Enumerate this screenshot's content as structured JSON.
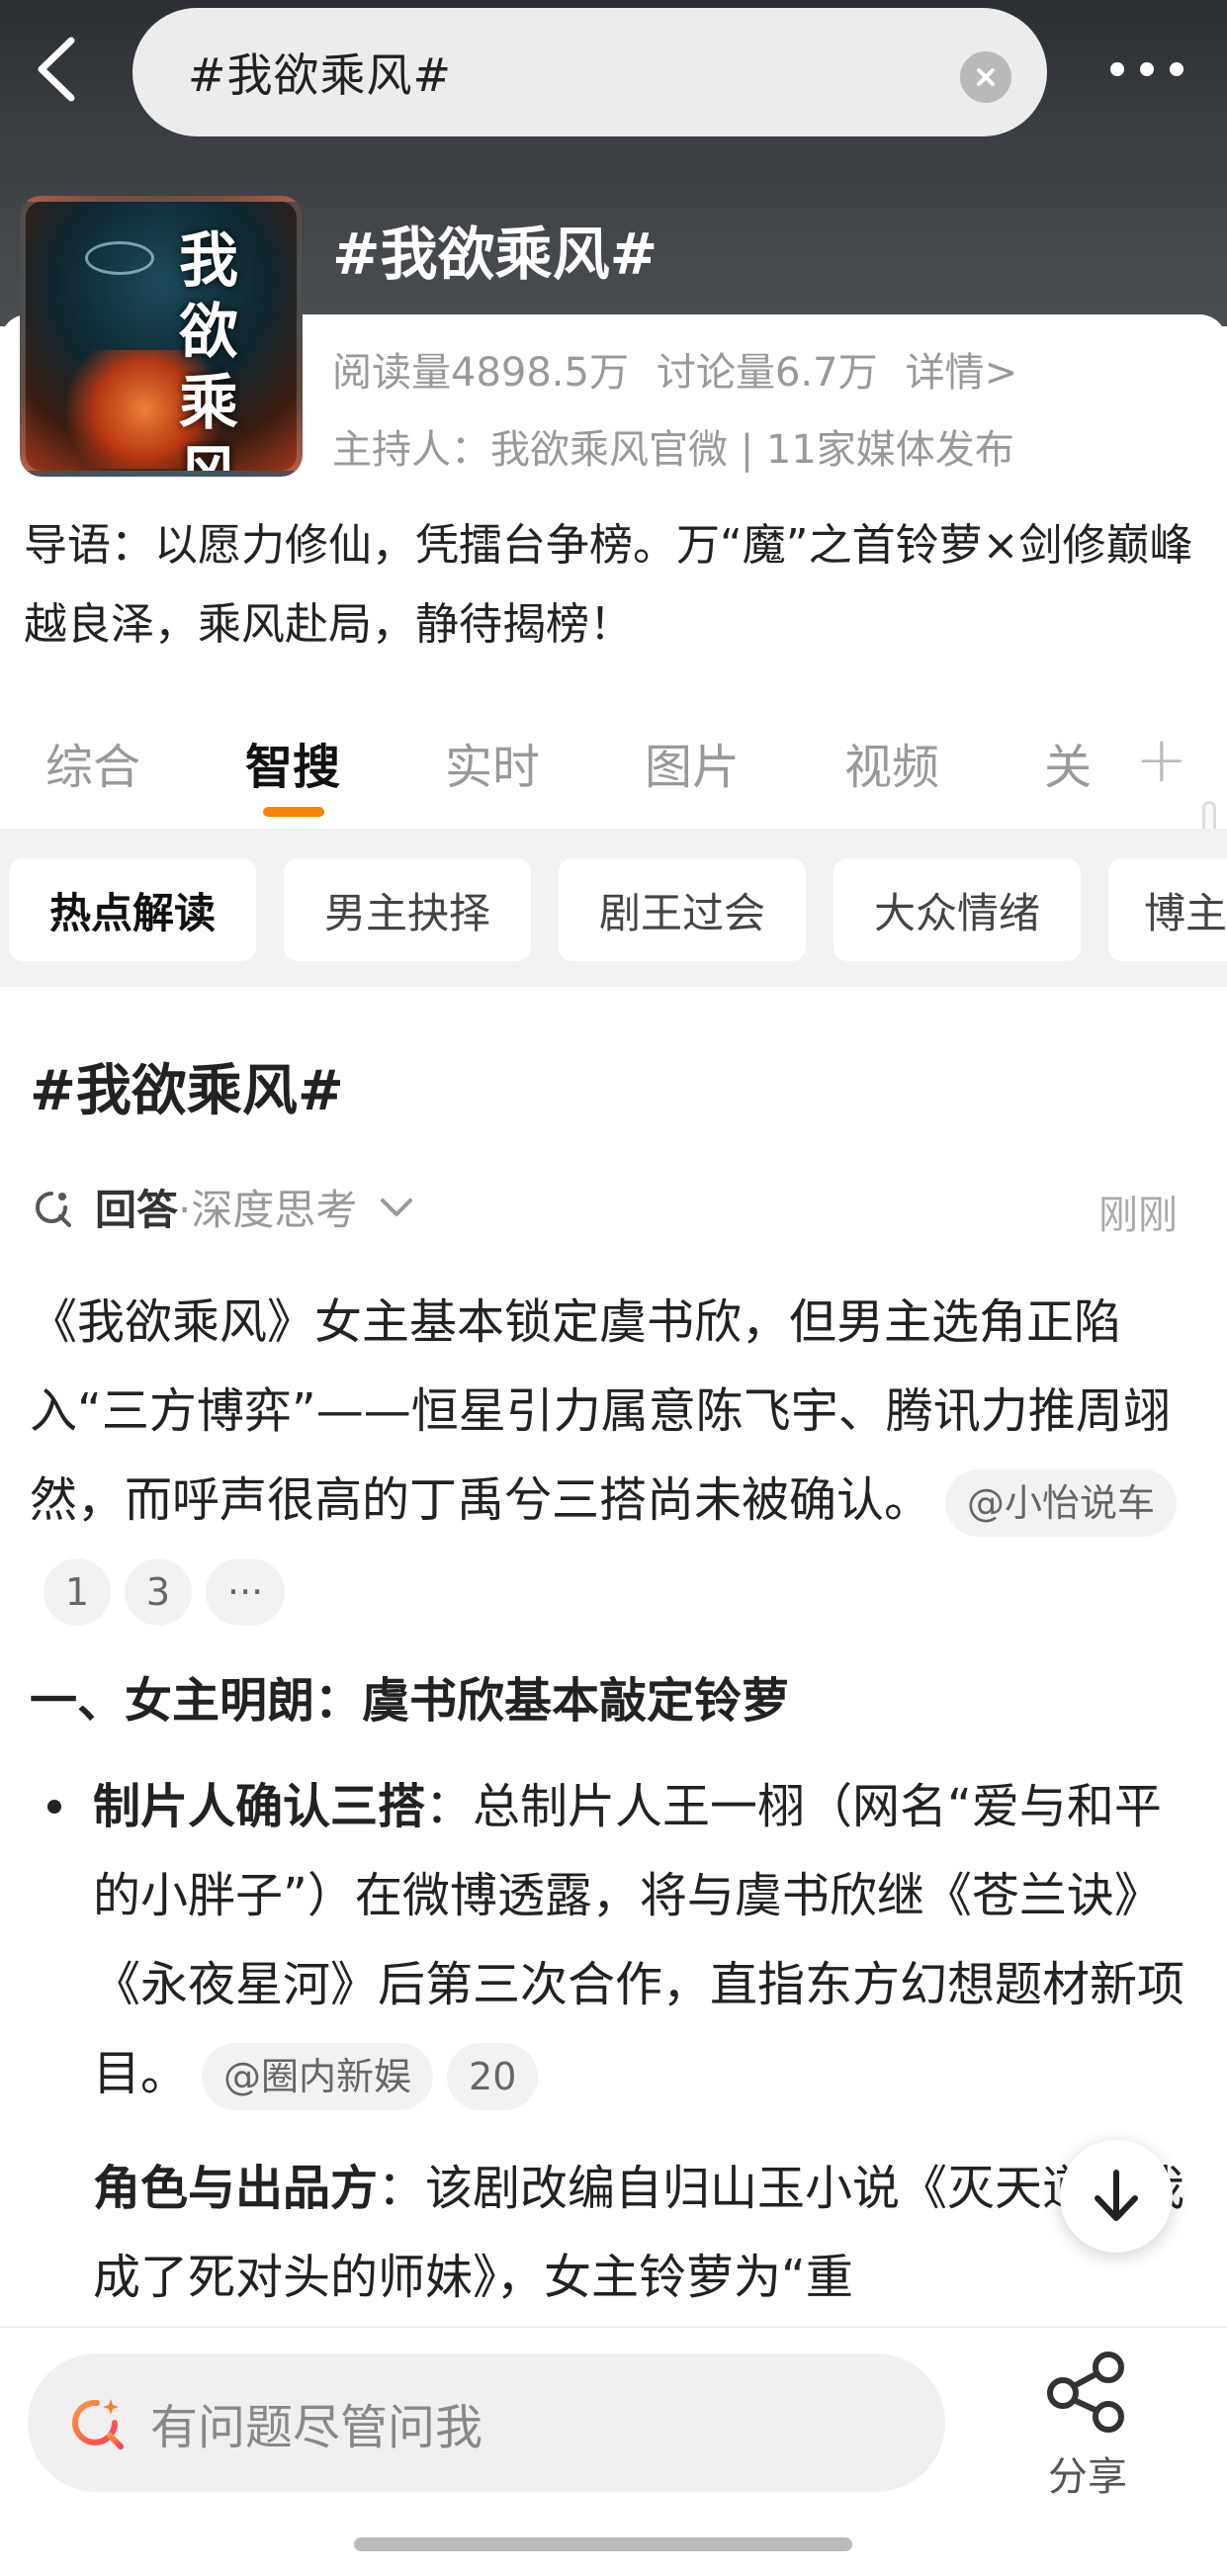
{
  "header": {
    "search_value": "#我欲乘风#",
    "topic_title": "#我欲乘风#",
    "cover_title_chars": "我欲乘风",
    "stats": {
      "reads": "阅读量4898.5万",
      "discussions": "讨论量6.7万",
      "details": "详情>"
    },
    "host": "主持人：我欲乘风官微 | 11家媒体发布",
    "intro": "导语：以愿力修仙，凭擂台争榜。万“魔”之首铃萝×剑修巅峰越良泽，乘风赴局，静待揭榜！"
  },
  "tabs": [
    {
      "label": "综合"
    },
    {
      "label": "智搜",
      "active": true
    },
    {
      "label": "实时"
    },
    {
      "label": "图片"
    },
    {
      "label": "视频"
    },
    {
      "label": "关"
    }
  ],
  "chips": [
    {
      "label": "热点解读",
      "active": true
    },
    {
      "label": "男主抉择"
    },
    {
      "label": "剧王过会"
    },
    {
      "label": "大众情绪"
    },
    {
      "label": "博主"
    }
  ],
  "answer": {
    "title": "#我欲乘风#",
    "label": "回答",
    "mode": "·深度思考",
    "time": "刚刚",
    "para1": "《我欲乘风》女主基本锁定虞书欣，但男主选角正陷入“三方博弈”——恒星引力属意陈飞宇、腾讯力推周翊然，而呼声很高的丁禹兮三搭尚未被确认。",
    "para1_source": "@小怡说车",
    "para1_refs": [
      "1",
      "3"
    ],
    "para1_more": "···",
    "section1": "一、女主明朗：虞书欣基本敲定铃萝",
    "bullet1_head": "制片人确认三搭",
    "bullet1_body": "：总制片人王一栩（网名“爱与和平的小胖子”）在微博透露，将与虞书欣继《苍兰诀》《永夜星河》后第三次合作，直指东方幻想题材新项目。",
    "bullet1_source": "@圈内新娱",
    "bullet1_ref": "20",
    "bullet2_head": "角色与出品方",
    "bullet2_body": "：该剧改编自归山玉小说《灭天道后我成了死对头的师妹》，女主铃萝为“重"
  },
  "bottom": {
    "ask_placeholder": "有问题尽管问我",
    "share_label": "分享"
  },
  "colors": {
    "accent": "#ff8200",
    "hero_bg": "#3a3d42"
  }
}
